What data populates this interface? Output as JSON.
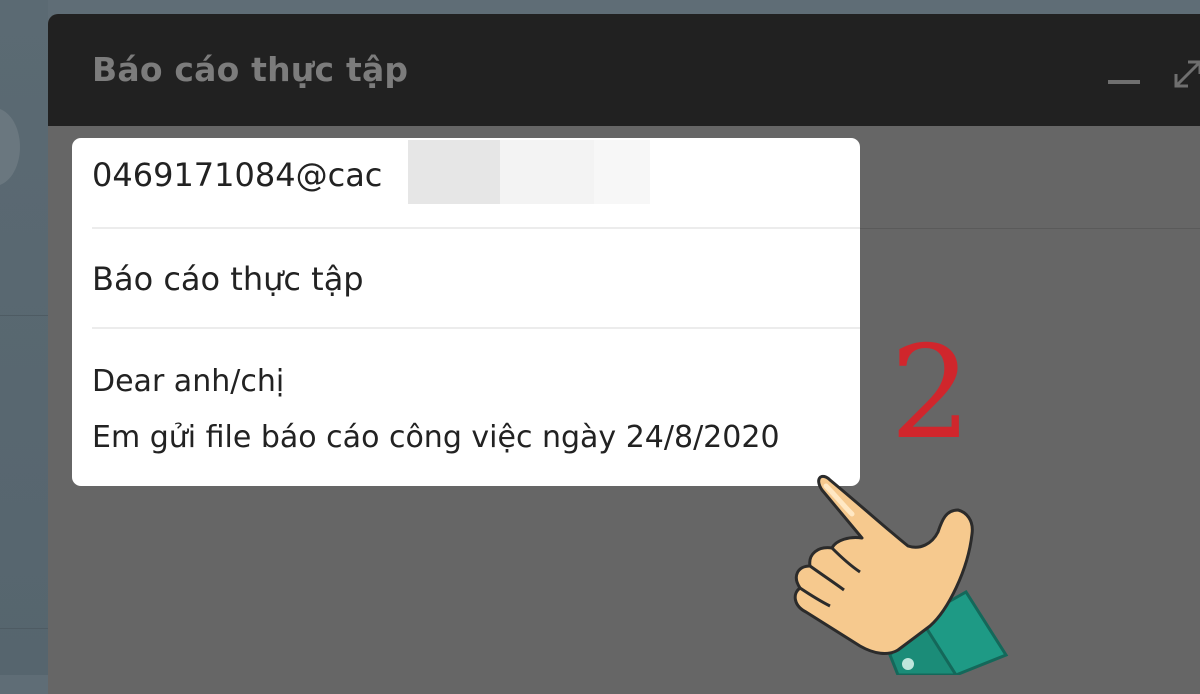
{
  "compose": {
    "title": "Báo cáo thực tập",
    "to": "0469171084@cac",
    "subject": "Báo cáo thực tập",
    "body_line1": "Dear anh/chị",
    "body_line2": "Em gửi file báo cáo công việc ngày 24/8/2020"
  },
  "annotation": {
    "step_number": "2",
    "step_color": "#d0262c",
    "pointer_icon": "pointing-hand-icon"
  },
  "colors": {
    "header_bg": "#212121",
    "dim_overlay": "#666666",
    "card_bg": "#ffffff"
  }
}
